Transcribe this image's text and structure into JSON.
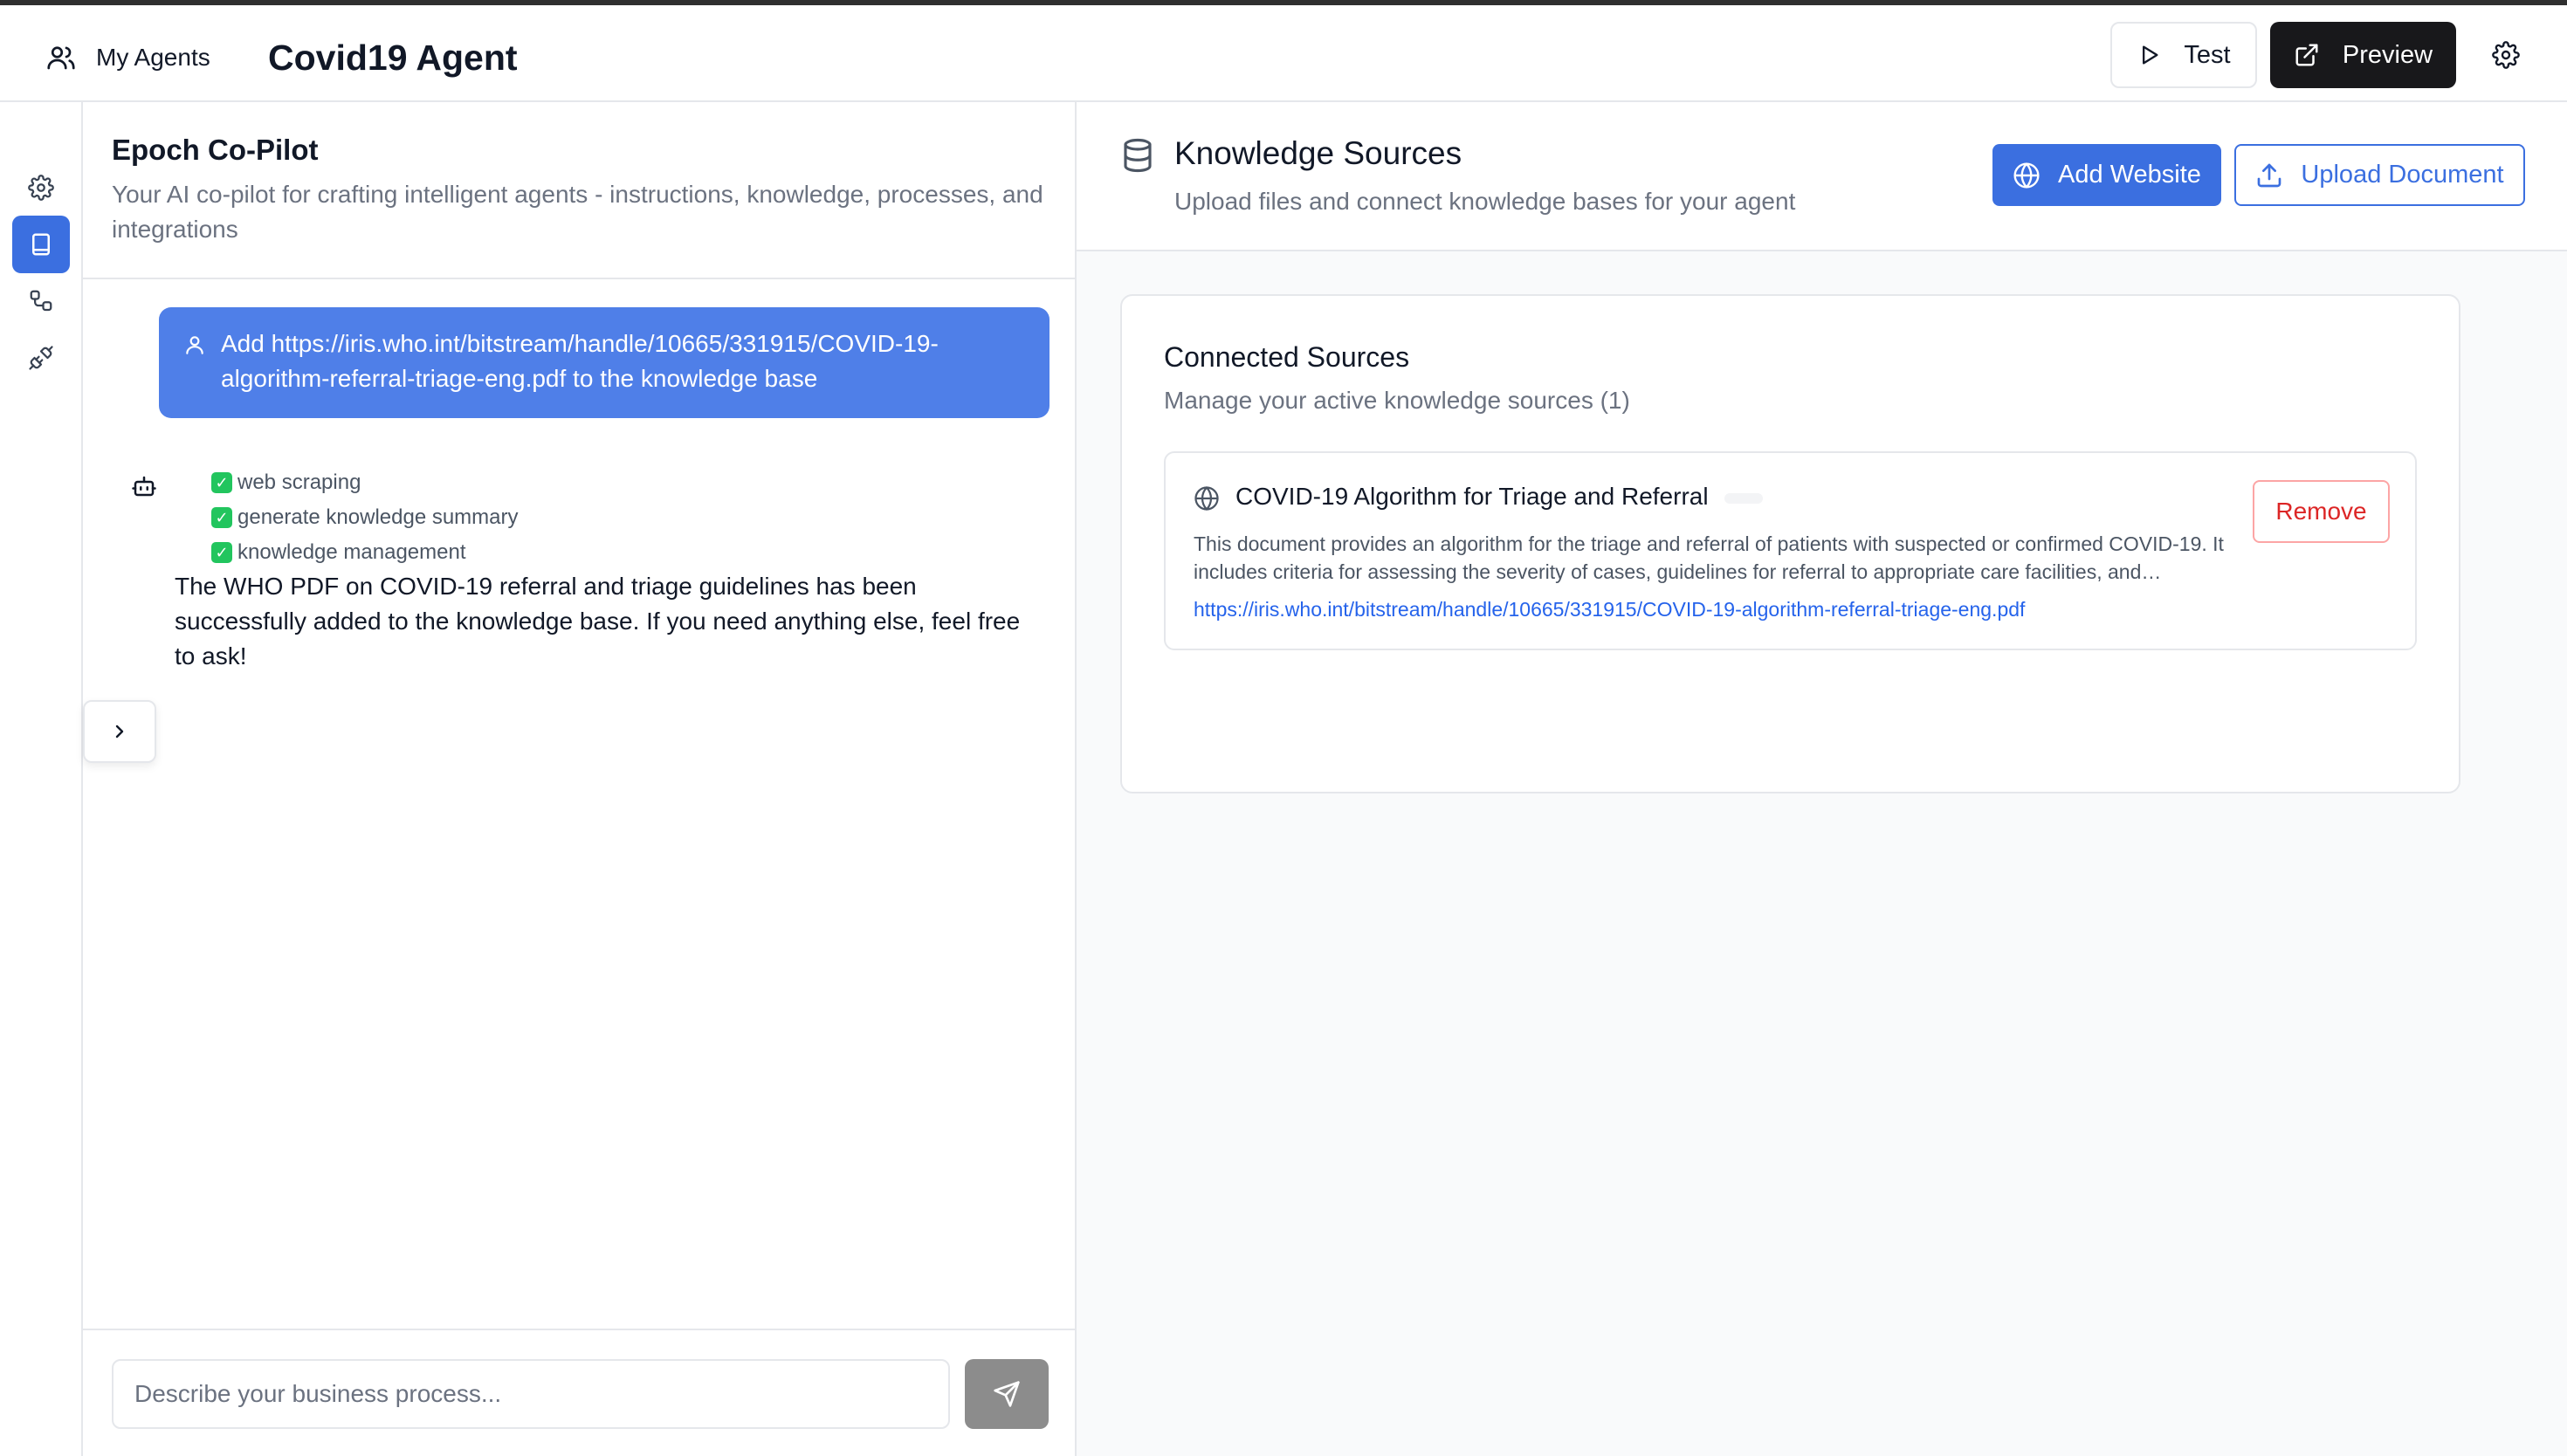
{
  "header": {
    "my_agents_label": "My Agents",
    "agent_title": "Covid19 Agent",
    "test_label": "Test",
    "preview_label": "Preview"
  },
  "rail": {
    "items": [
      {
        "icon": "gear-icon",
        "active": false
      },
      {
        "icon": "book-icon",
        "active": true
      },
      {
        "icon": "workflow-icon",
        "active": false
      },
      {
        "icon": "plug-icon",
        "active": false
      }
    ],
    "active_color": "#3b6fe0"
  },
  "copilot": {
    "title": "Epoch Co-Pilot",
    "subtitle": "Your AI co-pilot for crafting intelligent agents - instructions, knowledge, processes, and integrations",
    "user_message": "Add https://iris.who.int/bitstream/handle/10665/331915/COVID-19-algorithm-referral-triage-eng.pdf to the knowledge base",
    "tools": [
      "web scraping",
      "generate knowledge summary",
      "knowledge management"
    ],
    "bot_message": "The WHO PDF on COVID-19 referral and triage guidelines has been successfully added to the knowledge base. If you need anything else, feel free to ask!",
    "input_placeholder": "Describe your business process..."
  },
  "knowledge": {
    "title": "Knowledge Sources",
    "subtitle": "Upload files and connect knowledge bases for your agent",
    "add_website_label": "Add Website",
    "upload_document_label": "Upload Document",
    "connected_title": "Connected Sources",
    "connected_subtitle": "Manage your active knowledge sources (1)",
    "sources": [
      {
        "title": "COVID-19 Algorithm for Triage and Referral",
        "description": "This document provides an algorithm for the triage and referral of patients with suspected or confirmed COVID-19. It includes criteria for assessing the severity of cases, guidelines for referral to appropriate care facilities, and recommendations for managing patients at different levels of the health system.",
        "url": "https://iris.who.int/bitstream/handle/10665/331915/COVID-19-algorithm-referral-triage-eng.pdf",
        "remove_label": "Remove"
      }
    ]
  },
  "colors": {
    "accent": "#3b6fe0",
    "user_bubble": "#4f7fe8",
    "preview_button": "#18181b",
    "remove": "#dc2626"
  }
}
